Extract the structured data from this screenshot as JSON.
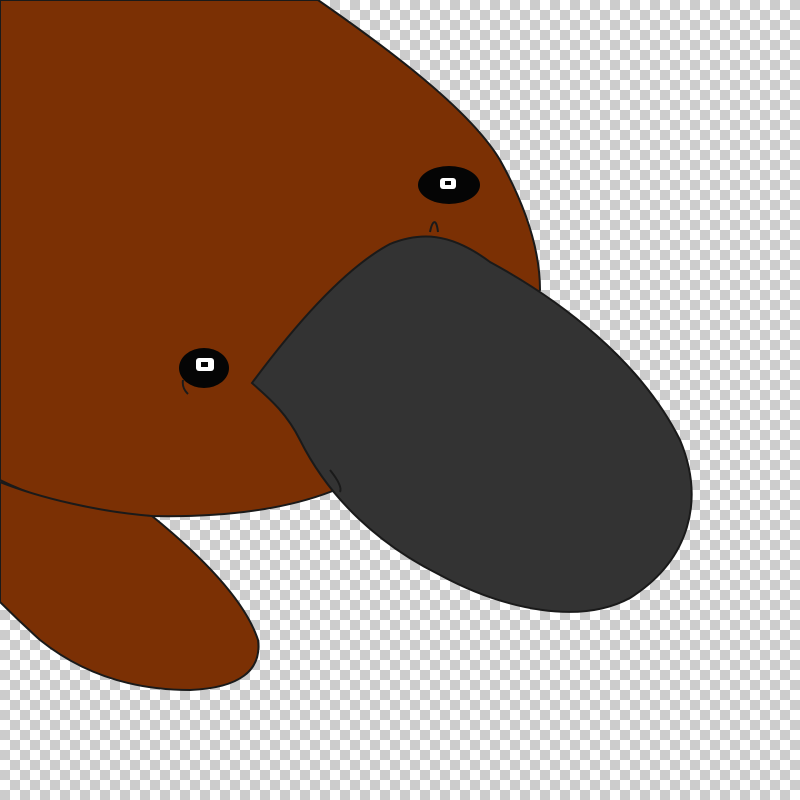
{
  "scene": {
    "subject": "platypus-illustration",
    "background": "transparency-checkerboard"
  },
  "colors": {
    "body": "#7b3004",
    "bill": "#333333",
    "outline": "#1a1a1a",
    "eye": "#050505",
    "eye_highlight": "#ffffff",
    "checker_light": "#ffffff",
    "checker_dark": "#cccccc"
  }
}
